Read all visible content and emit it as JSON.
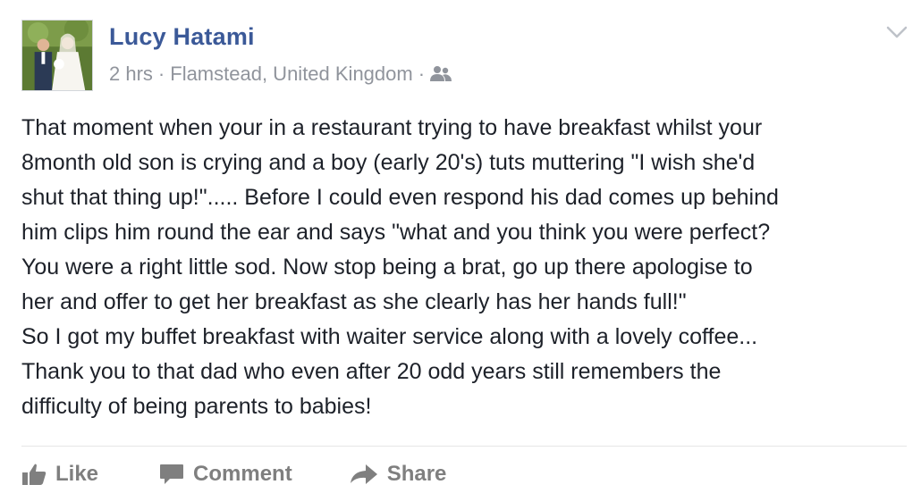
{
  "post": {
    "author": "Lucy Hatami",
    "time": "2 hrs",
    "separator": "·",
    "location": "Flamstead, United Kingdom",
    "audience_icon": "friends-icon",
    "menu_icon": "chevron-down-icon",
    "body_lines": [
      "That moment when your in a restaurant trying to have breakfast whilst your",
      "8month old son is crying and a boy (early 20's) tuts muttering \"I wish she'd",
      "shut that thing up!\"..... Before I could even respond his dad comes up behind",
      "him clips him round the ear and says \"what and you think you were perfect?",
      "You were a right little sod. Now stop being a brat, go up there apologise to",
      "her and offer to get her breakfast as she clearly has her hands full!\"",
      "So I got my buffet breakfast with waiter service along with a lovely coffee...",
      "Thank you to that dad who even after 20 odd years still remembers the",
      "difficulty of being parents to babies!"
    ]
  },
  "actions": {
    "like_label": "Like",
    "comment_label": "Comment",
    "share_label": "Share"
  },
  "colors": {
    "author_link": "#3b5998",
    "meta_text": "#90949c",
    "body_text": "#1d2129",
    "action_text": "#7f7f7f"
  }
}
